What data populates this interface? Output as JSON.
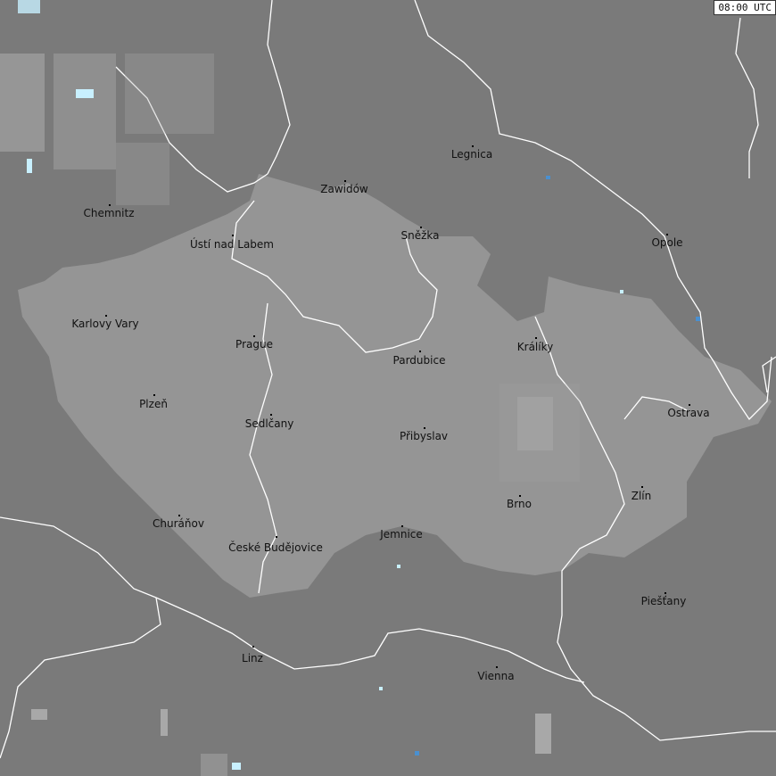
{
  "timestamp": "08:00 UTC",
  "cities": [
    {
      "id": "legnica",
      "name": "Legnica"
    },
    {
      "id": "zawidow",
      "name": "Zawidów"
    },
    {
      "id": "chemnitz",
      "name": "Chemnitz"
    },
    {
      "id": "snezka",
      "name": "Sněžka"
    },
    {
      "id": "opole",
      "name": "Opole"
    },
    {
      "id": "usti",
      "name": "Ústí nad Labem"
    },
    {
      "id": "karlovy-vary",
      "name": "Karlovy Vary"
    },
    {
      "id": "prague",
      "name": "Prague"
    },
    {
      "id": "kraliky",
      "name": "Králíky"
    },
    {
      "id": "pardubice",
      "name": "Pardubice"
    },
    {
      "id": "plzen",
      "name": "Plzeň"
    },
    {
      "id": "ostrava",
      "name": "Ostrava"
    },
    {
      "id": "sedlcany",
      "name": "Sedlčany"
    },
    {
      "id": "pribyslav",
      "name": "Přibyslav"
    },
    {
      "id": "zlin",
      "name": "Zlín"
    },
    {
      "id": "brno",
      "name": "Brno"
    },
    {
      "id": "churanov",
      "name": "Churáňov"
    },
    {
      "id": "jemnice",
      "name": "Jemnice"
    },
    {
      "id": "ceske-budejovice",
      "name": "České Budějovice"
    },
    {
      "id": "piestany",
      "name": "Piešťany"
    },
    {
      "id": "linz",
      "name": "Linz"
    },
    {
      "id": "vienna",
      "name": "Vienna"
    }
  ],
  "colors": {
    "background": "#7a7a7a",
    "czech_region": "#959595",
    "border_line": "#ffffff",
    "label_text": "#111111",
    "radar_light": "#a8a8a8",
    "radar_cyan": "#c8f0ff",
    "radar_blue": "#4a90d0"
  }
}
